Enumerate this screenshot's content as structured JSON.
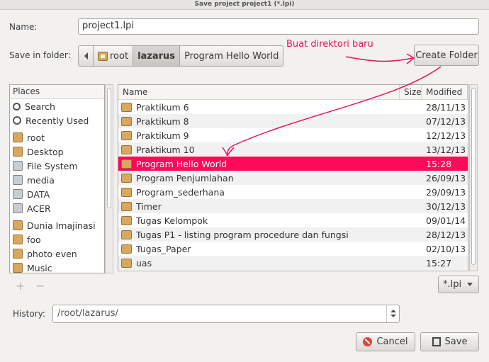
{
  "window": {
    "title": "Save project project1 (*.lpi)"
  },
  "name_label": "Name:",
  "name_value": "project1.lpi",
  "save_in_label": "Save in folder:",
  "path": [
    "root",
    "lazarus",
    "Program Hello World"
  ],
  "create_folder_label": "Create Folder",
  "annotation": "Buat direktori baru",
  "places": {
    "header": "Places",
    "items": [
      {
        "label": "Search",
        "icon": "search-icon"
      },
      {
        "label": "Recently Used",
        "icon": "recent-icon"
      },
      {
        "label": "root",
        "icon": "home-folder-icon"
      },
      {
        "label": "Desktop",
        "icon": "folder-icon"
      },
      {
        "label": "File System",
        "icon": "drive-icon"
      },
      {
        "label": "media",
        "icon": "drive-icon"
      },
      {
        "label": "DATA",
        "icon": "drive-icon"
      },
      {
        "label": "ACER",
        "icon": "drive-icon"
      },
      {
        "label": "Dunia Imajinasi",
        "icon": "folder-icon"
      },
      {
        "label": "foo",
        "icon": "folder-icon"
      },
      {
        "label": "photo even",
        "icon": "folder-icon"
      },
      {
        "label": "Music",
        "icon": "folder-icon"
      }
    ]
  },
  "files": {
    "headers": {
      "name": "Name",
      "size": "Size",
      "modified": "Modified"
    },
    "rows": [
      {
        "name": "Praktikum 6",
        "size": "",
        "modified": "28/11/13"
      },
      {
        "name": "Praktikum 8",
        "size": "",
        "modified": "07/12/13"
      },
      {
        "name": "Praktikum 9",
        "size": "",
        "modified": "12/12/13"
      },
      {
        "name": "Praktikum 10",
        "size": "",
        "modified": "13/12/13"
      },
      {
        "name": "Program Hello World",
        "size": "",
        "modified": "15:28",
        "selected": true
      },
      {
        "name": "Program Penjumlahan",
        "size": "",
        "modified": "26/09/13"
      },
      {
        "name": "Program_sederhana",
        "size": "",
        "modified": "29/09/13"
      },
      {
        "name": "Timer",
        "size": "",
        "modified": "30/12/13"
      },
      {
        "name": "Tugas Kelompok",
        "size": "",
        "modified": "09/01/14"
      },
      {
        "name": "Tugas P1 - listing program procedure dan fungsi",
        "size": "",
        "modified": "28/12/13"
      },
      {
        "name": "Tugas_Paper",
        "size": "",
        "modified": "02/10/13"
      },
      {
        "name": "uas",
        "size": "",
        "modified": "15:27"
      }
    ]
  },
  "filter_value": "*.lpi",
  "add_symbol": "+",
  "remove_symbol": "−",
  "history_label": "History:",
  "history_value": "/root/lazarus/",
  "cancel_label": "Cancel",
  "save_label": "Save",
  "colors": {
    "selection": "#ff0a58",
    "annotation": "#e8145a"
  }
}
